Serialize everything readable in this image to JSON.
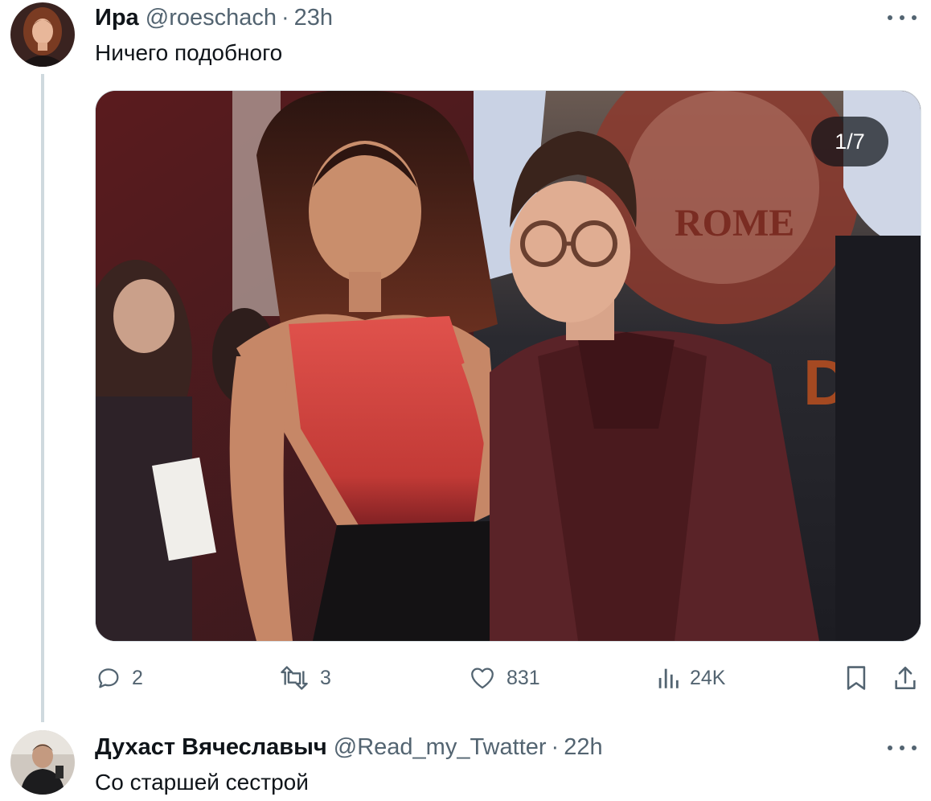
{
  "tweets": [
    {
      "display_name": "Ира",
      "handle": "@roeschach",
      "time": "23h",
      "text": "Ничего подобного",
      "avatar_icon": "user-avatar-illustrated-woman",
      "media": {
        "counter": "1/7"
      },
      "actions": {
        "reply": {
          "icon": "reply-bubble-icon",
          "count": "2"
        },
        "retweet": {
          "icon": "retweet-icon",
          "count": "3"
        },
        "like": {
          "icon": "heart-icon",
          "count": "831"
        },
        "views": {
          "icon": "views-bar-chart-icon",
          "count": "24K"
        },
        "bookmark": {
          "icon": "bookmark-icon"
        },
        "share": {
          "icon": "share-upload-icon"
        }
      }
    },
    {
      "display_name": "Духаст Вячеславыч",
      "handle": "@Read_my_Twatter",
      "time": "22h",
      "text": "Со старшей сестрой",
      "avatar_icon": "user-avatar-photo-man"
    }
  ],
  "colors": {
    "text_primary": "#0f1419",
    "text_secondary": "#536471",
    "thread_line": "#cfd9de"
  }
}
